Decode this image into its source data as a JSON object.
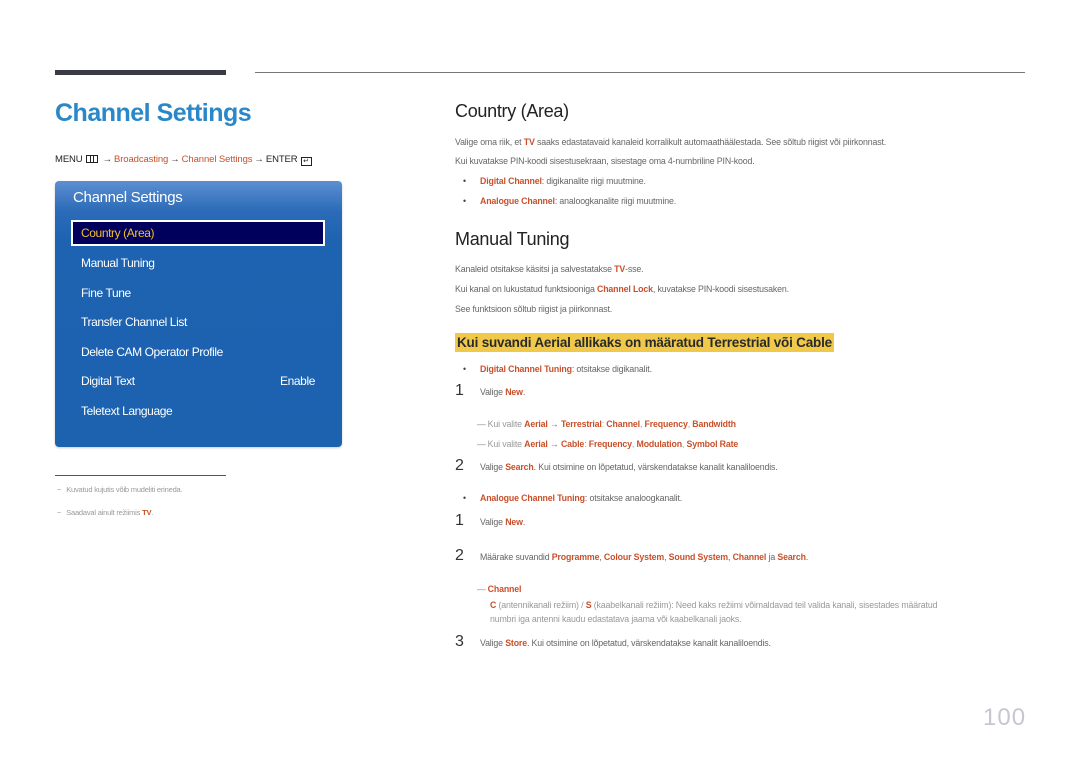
{
  "page": {
    "title": "Channel Settings",
    "page_number": "100"
  },
  "menu_path": {
    "menu_label": "MENU",
    "menu_icon": "menu-grid-icon",
    "arrow": "→",
    "items": [
      "Broadcasting",
      "Channel Settings"
    ],
    "enter_label": "ENTER",
    "enter_icon": "enter-icon"
  },
  "osd": {
    "title": "Channel Settings",
    "items": [
      {
        "label": "Country (Area)",
        "selected": true
      },
      {
        "label": "Manual Tuning"
      },
      {
        "label": "Fine Tune"
      },
      {
        "label": "Transfer Channel List"
      },
      {
        "label": "Delete CAM Operator Profile"
      },
      {
        "label": "Digital Text",
        "value": "Enable"
      },
      {
        "label": "Teletext Language"
      }
    ]
  },
  "footnotes": [
    {
      "dash": "−",
      "text": "Kuvatud kujutis võib mudeliti erineda."
    },
    {
      "dash": "−",
      "text": "Saadaval ainult režiimis ",
      "highlight": "TV",
      "suffix": "."
    }
  ],
  "country_area": {
    "heading": "Country (Area)",
    "p1_a": "Valige oma riik, et ",
    "p1_hl": "TV",
    "p1_b": " saaks edastatavaid kanaleid korralikult automaathäälestada. See sõltub riigist või piirkonnast.",
    "p2": "Kui kuvatakse PIN-koodi sisestusekraan, sisestage oma 4-numbriline PIN-kood.",
    "bullets": [
      {
        "hl": "Digital Channel",
        "text": ": digikanalite riigi muutmine."
      },
      {
        "hl": "Analogue Channel",
        "text": ": analoogkanalite riigi muutmine."
      }
    ]
  },
  "manual_tuning": {
    "heading": "Manual Tuning",
    "p1_a": "Kanaleid otsitakse käsitsi ja salvestatakse ",
    "p1_hl": "TV",
    "p1_b": "-sse.",
    "p2_a": "Kui kanal on lukustatud funktsiooniga ",
    "p2_hl": "Channel Lock",
    "p2_b": ", kuvatakse PIN-koodi sisestusaken.",
    "p3": "See funktsioon sõltub riigist ja piirkonnast.",
    "subheading": "Kui suvandi Aerial allikaks on määratud Terrestrial või Cable",
    "digital": {
      "bullet_hl": "Digital Channel Tuning",
      "bullet_text": ": otsitakse digikanalit.",
      "step1_num": "1",
      "step1_a": "Valige ",
      "step1_hl": "New",
      "step1_b": ".",
      "note1_prefix": "Kui valite ",
      "note1_a": "Aerial",
      "note1_arrow": " → ",
      "note1_b": "Terrestrial",
      "note1_sep": ": ",
      "note1_c": "Channel",
      "note1_d": "Frequency",
      "note1_e": "Bandwidth",
      "note2_prefix": "Kui valite ",
      "note2_a": "Aerial",
      "note2_arrow": " → ",
      "note2_b": "Cable",
      "note2_sep": ": ",
      "note2_c": "Frequency",
      "note2_d": "Modulation",
      "note2_e": "Symbol Rate",
      "step2_num": "2",
      "step2_a": "Valige ",
      "step2_hl": "Search",
      "step2_b": ". Kui otsimine on lõpetatud, värskendatakse kanalit kanaliloendis."
    },
    "analogue": {
      "bullet_hl": "Analogue Channel Tuning",
      "bullet_text": ": otsitakse analoogkanalit.",
      "step1_num": "1",
      "step1_a": "Valige ",
      "step1_hl": "New",
      "step1_b": ".",
      "step2_num": "2",
      "step2_a": "Määrake suvandid ",
      "step2_hl1": "Programme",
      "step2_hl2": "Colour System",
      "step2_hl3": "Sound System",
      "step2_hl4": "Channel",
      "step2_ja": " ja ",
      "step2_hl5": "Search",
      "step2_end": ".",
      "channel_note_title": "Channel",
      "channel_note_c": "C",
      "channel_note_c_text": " (antennikanali režiim) / ",
      "channel_note_s": "S",
      "channel_note_s_text": " (kaabelkanali režiim): Need kaks režiimi võimaldavad teil valida kanali, sisestades määratud",
      "channel_note_line2": "numbri iga antenni kaudu edastatava jaama või kaabelkanali jaoks.",
      "step3_num": "3",
      "step3_a": "Valige ",
      "step3_hl": "Store",
      "step3_b": ". Kui otsimine on lõpetatud, värskendatakse kanalit kanaliloendis."
    }
  },
  "colors": {
    "title_blue": "#2a87c8",
    "highlight_orange": "#c9502a",
    "osd_blue": "#1d63b1",
    "osd_selected_bg": "#00005c",
    "osd_selected_text": "#f2c02c",
    "subheading_bg": "#f0c94a"
  }
}
